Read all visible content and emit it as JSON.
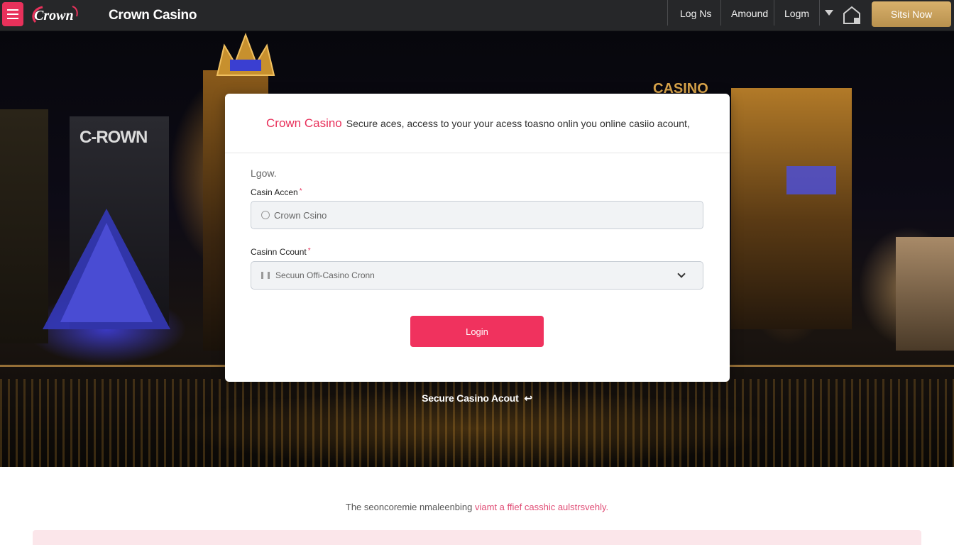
{
  "header": {
    "logo_text": "Crown",
    "brand": "Crown Casino",
    "nav": [
      {
        "label": "Log Ns"
      },
      {
        "label": "Amound"
      },
      {
        "label": "Logm"
      }
    ],
    "cta_label": "Sitsi Now"
  },
  "hero": {
    "sign_text": "C-ROWN",
    "sign_text_2": "CASINO"
  },
  "card": {
    "title_brand": "Crown Casino",
    "title_text": "Secure aces, access to your your acess toasno onlin you online casiio acount,",
    "section_label": "Lgow.",
    "field1": {
      "label": "Casin Accen",
      "value": "Crown Csino"
    },
    "field2": {
      "label": "Casinn Ccount",
      "value": "Secuun Offi-Casino Cronn"
    },
    "login_label": "Login"
  },
  "secure_note": "Secure Casino Acout",
  "footer": {
    "text_plain": "The seoncoremie nmaleenbing",
    "text_pink": "viamt a ffief casshic aulstrsvehly."
  },
  "colors": {
    "accent": "#f0325e",
    "topbar": "#262729",
    "cta": "#c9a15c"
  }
}
